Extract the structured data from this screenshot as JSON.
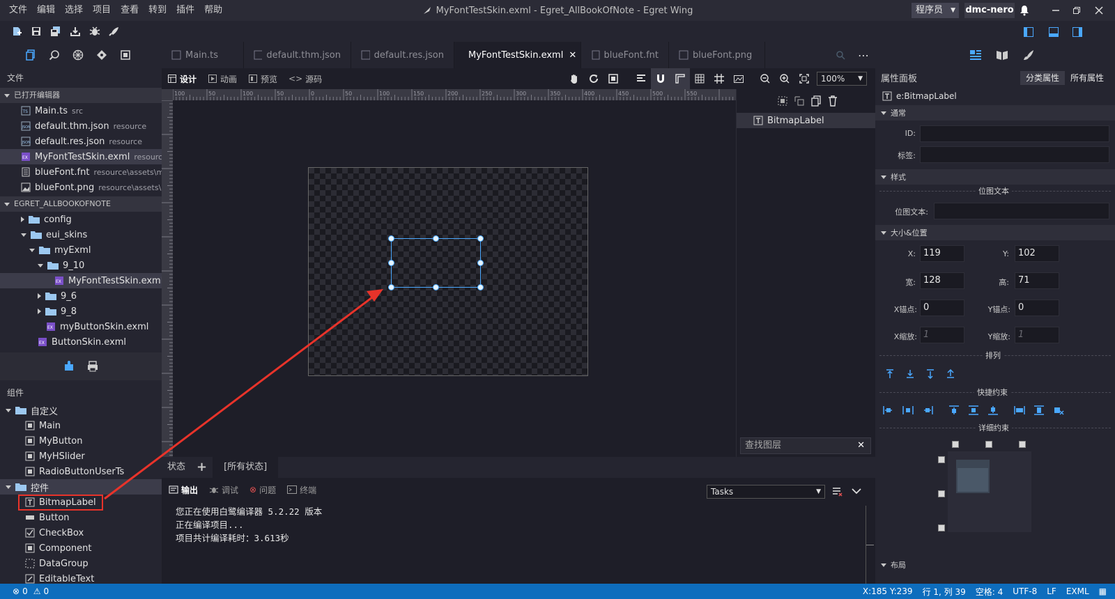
{
  "menu": [
    "文件",
    "编辑",
    "选择",
    "项目",
    "查看",
    "转到",
    "插件",
    "帮助"
  ],
  "window_title": "MyFontTestSkin.exml - Egret_AllBookOfNote - Egret Wing",
  "role": "程序员",
  "user": "dmc-nero",
  "sidebar": {
    "header": "文件",
    "open_editors_label": "已打开编辑器",
    "open_editors": [
      {
        "name": "Main.ts",
        "path": "src"
      },
      {
        "name": "default.thm.json",
        "path": "resource"
      },
      {
        "name": "default.res.json",
        "path": "resource"
      },
      {
        "name": "MyFontTestSkin.exml",
        "path": "resourc..."
      },
      {
        "name": "blueFont.fnt",
        "path": "resource\\assets\\m..."
      },
      {
        "name": "blueFont.png",
        "path": "resource\\assets\\..."
      }
    ],
    "project_label": "EGRET_ALLBOOKOFNOTE",
    "tree": [
      "config",
      "eui_skins",
      "myExml",
      "9_10",
      "MyFontTestSkin.exml",
      "9_6",
      "9_8",
      "myButtonSkin.exml",
      "ButtonSkin.exml"
    ],
    "components_label": "组件",
    "custom_label": "自定义",
    "custom_items": [
      "Main",
      "MyButton",
      "MyHSlider",
      "RadioButtonUserTs"
    ],
    "controls_label": "控件",
    "control_items": [
      "BitmapLabel",
      "Button",
      "CheckBox",
      "Component",
      "DataGroup",
      "EditableText"
    ]
  },
  "tabs": [
    "Main.ts",
    "default.thm.json",
    "default.res.json",
    "MyFontTestSkin.exml",
    "blueFont.fnt",
    "blueFont.png"
  ],
  "design_modes": [
    "设计",
    "动画",
    "预览",
    "源码"
  ],
  "zoom": "100%",
  "ruler_labels": [
    "100",
    "50",
    "100",
    "50",
    "0",
    "50",
    "100",
    "150",
    "200",
    "250",
    "300",
    "350",
    "400",
    "450",
    "500",
    "550"
  ],
  "layers": {
    "item": "BitmapLabel",
    "search_placeholder": "查找图层"
  },
  "state_bar": {
    "label": "状态",
    "add": "+",
    "all": "[所有状态]"
  },
  "output_tabs": [
    "输出",
    "调试",
    "问题",
    "终端"
  ],
  "tasks": "Tasks",
  "output_lines": [
    "您正在使用白鹭编译器 5.2.22 版本",
    "正在编译项目...",
    "项目共计编译耗时：3.613秒"
  ],
  "props": {
    "title": "属性面板",
    "tab_category": "分类属性",
    "tab_all": "所有属性",
    "component": "e:BitmapLabel",
    "cat_common": "通常",
    "id_label": "ID:",
    "tag_label": "标签:",
    "cat_style": "样式",
    "bitmap_text_section": "位图文本",
    "bitmap_text_label": "位图文本:",
    "cat_size": "大小&位置",
    "x_label": "X:",
    "x": "119",
    "y_label": "Y:",
    "y": "102",
    "w_label": "宽:",
    "w": "128",
    "h_label": "高:",
    "h": "71",
    "ax_label": "X锚点:",
    "ax": "0",
    "ay_label": "Y锚点:",
    "ay": "0",
    "sx_label": "X缩放:",
    "sx": "1",
    "sy_label": "Y缩放:",
    "sy": "1",
    "arrange": "排列",
    "quick": "快捷约束",
    "detail": "详细约束",
    "cat_layout": "布局"
  },
  "status": {
    "errors": "0",
    "warnings": "0",
    "coords": "X:185 Y:239",
    "cursor": "行 1, 列 39",
    "spaces": "空格: 4",
    "encoding": "UTF-8",
    "eol": "LF",
    "lang": "EXML"
  },
  "colors": {
    "accent": "#0e6dbd",
    "selection": "#4aa8ff",
    "annotation": "#e8332a"
  }
}
